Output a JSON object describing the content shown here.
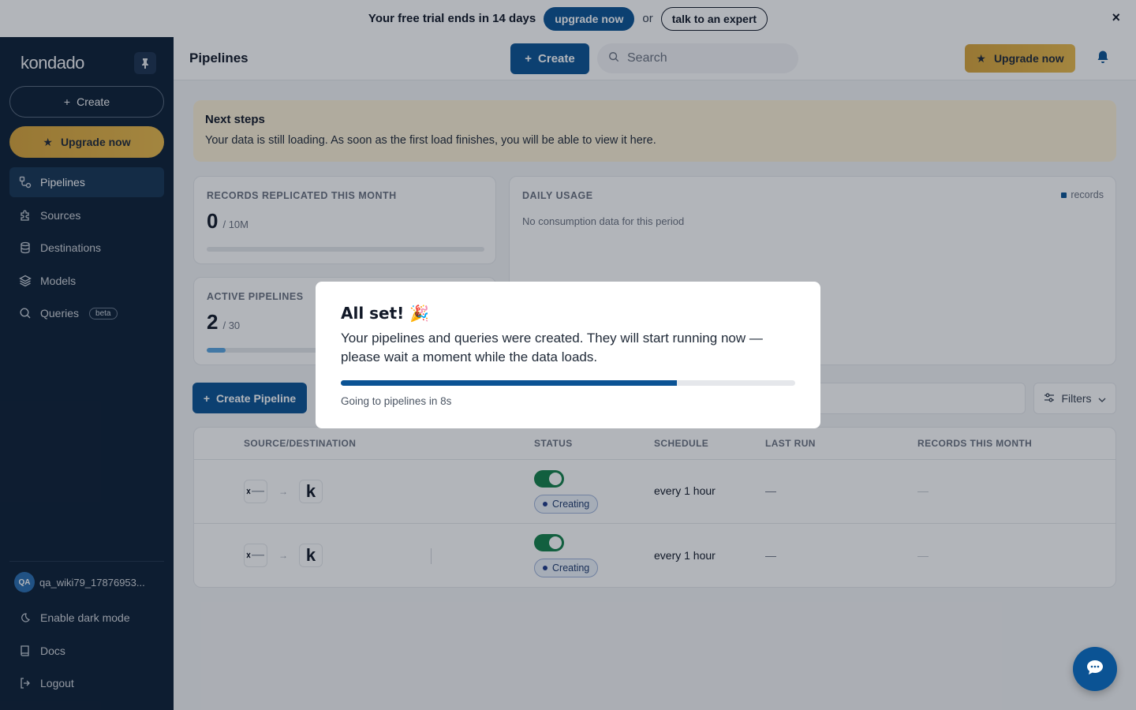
{
  "banner": {
    "trial_text": "Your free trial ends in 14 days",
    "upgrade_label": "upgrade now",
    "or_text": "or",
    "expert_label": "talk to an expert",
    "close_icon": "×"
  },
  "sidebar": {
    "logo": "kondado",
    "create_label": "Create",
    "upgrade_label": "Upgrade now",
    "items": [
      {
        "label": "Pipelines",
        "icon": "pipeline-icon",
        "active": true
      },
      {
        "label": "Sources",
        "icon": "puzzle-icon"
      },
      {
        "label": "Destinations",
        "icon": "database-icon"
      },
      {
        "label": "Models",
        "icon": "layers-icon"
      },
      {
        "label": "Queries",
        "icon": "search-icon",
        "badge": "beta"
      }
    ],
    "user": {
      "initials": "QA",
      "name": "qa_wiki79_17876953..."
    },
    "bottom_items": [
      {
        "label": "Enable dark mode",
        "icon": "moon-icon"
      },
      {
        "label": "Docs",
        "icon": "book-icon"
      },
      {
        "label": "Logout",
        "icon": "logout-icon"
      }
    ]
  },
  "header": {
    "title": "Pipelines",
    "create_label": "Create",
    "search_placeholder": "Search",
    "upgrade_label": "Upgrade now"
  },
  "next_steps": {
    "title": "Next steps",
    "text": "Your data is still loading. As soon as the first load finishes, you will be able to view it here."
  },
  "records_card": {
    "label": "RECORDS REPLICATED THIS MONTH",
    "value": "0",
    "limit": "/ 10M",
    "progress": 0.0
  },
  "active_card": {
    "label": "ACTIVE PIPELINES",
    "value": "2",
    "limit": "/ 30",
    "progress": 0.067
  },
  "usage_card": {
    "label": "DAILY USAGE",
    "legend": "records",
    "empty_text": "No consumption data for this period"
  },
  "table": {
    "create_label": "Create Pipeline",
    "filters_label": "Filters",
    "columns": [
      "SOURCE/DESTINATION",
      "STATUS",
      "SCHEDULE",
      "LAST RUN",
      "RECORDS THIS MONTH"
    ],
    "rows": [
      {
        "dest_logo": "k",
        "status": "Creating",
        "schedule": "every 1 hour",
        "last_run": "—",
        "records": "—"
      },
      {
        "dest_logo": "k",
        "status": "Creating",
        "schedule": "every 1 hour",
        "last_run": "—",
        "records": "—"
      }
    ]
  },
  "modal": {
    "title": "All set! 🎉",
    "body": "Your pipelines and queries were created. They will start running now — please wait a moment while the data loads.",
    "progress": 0.74,
    "redirect_text": "Going to pipelines in 8s"
  },
  "colors": {
    "primary": "#0b5394",
    "sidebar_bg": "#0d2036",
    "upgrade_gold": "#e0ae42",
    "toggle_on": "#14804a"
  }
}
